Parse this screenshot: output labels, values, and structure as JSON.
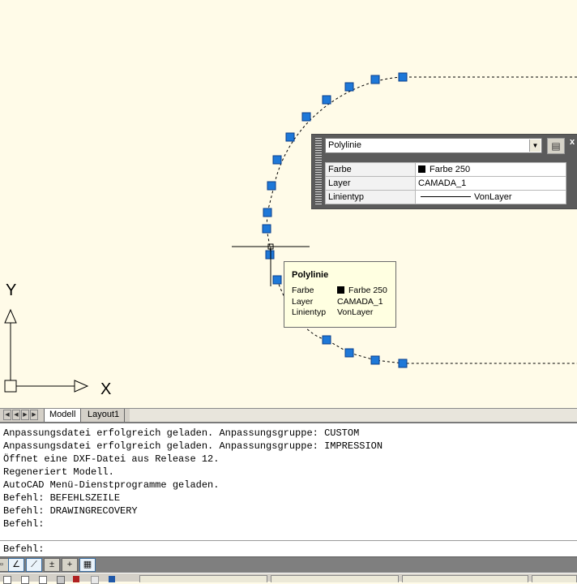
{
  "canvas": {
    "ucs": {
      "x_label": "X",
      "y_label": "Y"
    },
    "grip_color": "#1e78d8",
    "background": "#fffbe8"
  },
  "quick_properties": {
    "object_type": "Polylinie",
    "rows": [
      {
        "label": "Farbe",
        "value": "Farbe 250",
        "icon": "color-swatch"
      },
      {
        "label": "Layer",
        "value": "CAMADA_1"
      },
      {
        "label": "Linientyp",
        "value": "VonLayer",
        "icon": "linetype-line"
      }
    ],
    "close_glyph": "x"
  },
  "tooltip": {
    "title": "Polylinie",
    "rows": [
      {
        "label": "Farbe",
        "value": "Farbe 250"
      },
      {
        "label": "Layer",
        "value": "CAMADA_1"
      },
      {
        "label": "Linientyp",
        "value": "VonLayer"
      }
    ]
  },
  "layout_tabs": {
    "tabs": [
      {
        "label": "Modell",
        "active": true
      },
      {
        "label": "Layout1",
        "active": false
      }
    ]
  },
  "command_line": {
    "history": [
      "Anpassungsdatei erfolgreich geladen. Anpassungsgruppe: CUSTOM",
      "Anpassungsdatei erfolgreich geladen. Anpassungsgruppe: IMPRESSION",
      "Öffnet eine DXF-Datei aus Release 12.",
      "Regeneriert Modell.",
      "AutoCAD Menü-Dienstprogramme geladen.",
      "Befehl: BEFEHLSZEILE",
      "Befehl: DRAWINGRECOVERY",
      "Befehl:"
    ],
    "prompt": "Befehl:"
  },
  "status_bar": {
    "buttons": [
      {
        "name": "snap-toggle",
        "icon": "snap-icon",
        "active": false
      },
      {
        "name": "polar-toggle",
        "icon": "angle-icon",
        "active": true
      },
      {
        "name": "otrack-toggle",
        "icon": "osnap-track-icon",
        "active": true
      },
      {
        "name": "lineweight-toggle",
        "icon": "lineweight-icon",
        "active": false
      },
      {
        "name": "ortho-toggle",
        "icon": "crosshair-icon",
        "active": false
      },
      {
        "name": "quickprops-toggle",
        "icon": "quick-properties-icon",
        "active": true
      }
    ]
  }
}
